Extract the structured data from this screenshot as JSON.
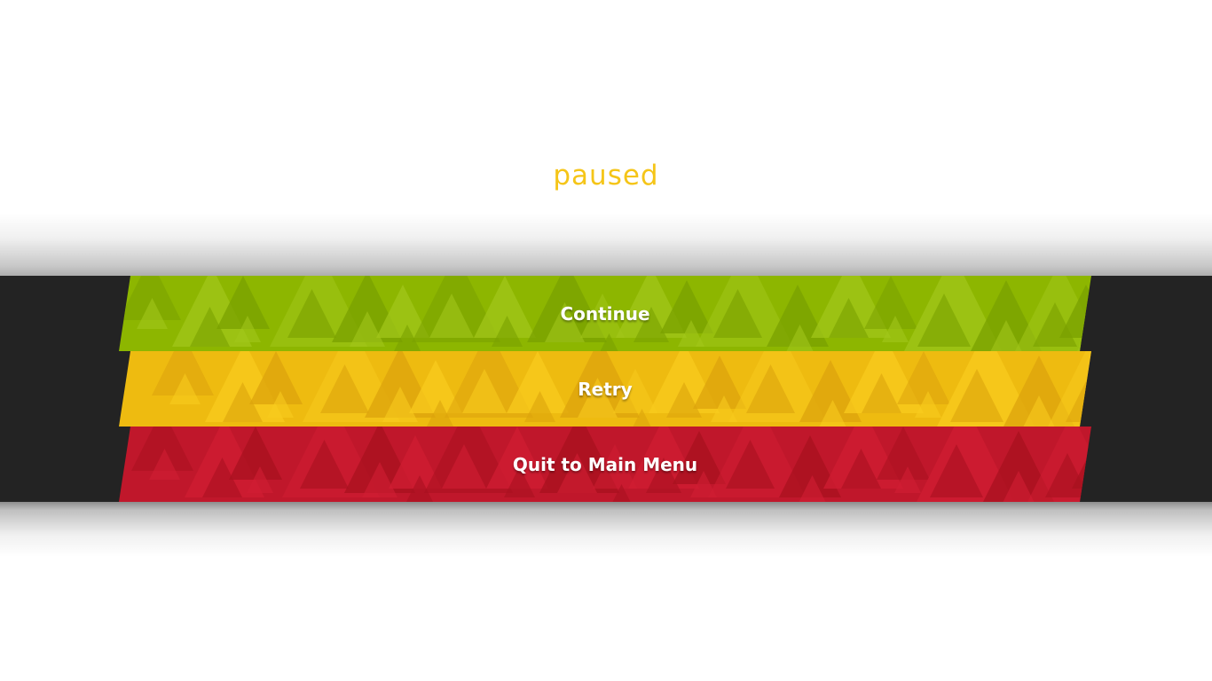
{
  "screen": {
    "title": "paused",
    "title_color": "#f5c518",
    "band_color": "#232323"
  },
  "menu": {
    "items": [
      {
        "id": "continue",
        "label": "Continue",
        "base_color": "#8db600",
        "light_color": "#a2c61a",
        "dark_color": "#7aa000"
      },
      {
        "id": "retry",
        "label": "Retry",
        "base_color": "#eebb10",
        "light_color": "#f8cb1e",
        "dark_color": "#dca30c"
      },
      {
        "id": "quit",
        "label": "Quit to Main Menu",
        "base_color": "#c0172b",
        "light_color": "#d01e33",
        "dark_color": "#a8111f"
      }
    ]
  }
}
